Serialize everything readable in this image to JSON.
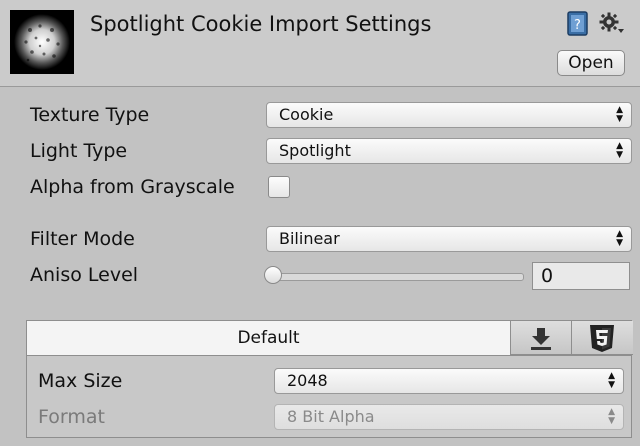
{
  "header": {
    "title": "Spotlight Cookie Import Settings",
    "open_label": "Open",
    "icons": [
      "book-help-icon",
      "gear-dropdown-icon"
    ]
  },
  "settings": {
    "texture_type": {
      "label": "Texture Type",
      "value": "Cookie"
    },
    "light_type": {
      "label": "Light Type",
      "value": "Spotlight"
    },
    "alpha_from_grayscale": {
      "label": "Alpha from Grayscale",
      "checked": false
    },
    "filter_mode": {
      "label": "Filter Mode",
      "value": "Bilinear"
    },
    "aniso_level": {
      "label": "Aniso Level",
      "value": "0",
      "slider_fraction": 0
    }
  },
  "platform": {
    "tabs": [
      {
        "label": "Default",
        "selected": true
      },
      {
        "icon": "download-icon"
      },
      {
        "icon": "html5-icon"
      }
    ],
    "max_size": {
      "label": "Max Size",
      "value": "2048"
    },
    "format": {
      "label": "Format",
      "value": "8 Bit Alpha",
      "disabled": true
    }
  }
}
